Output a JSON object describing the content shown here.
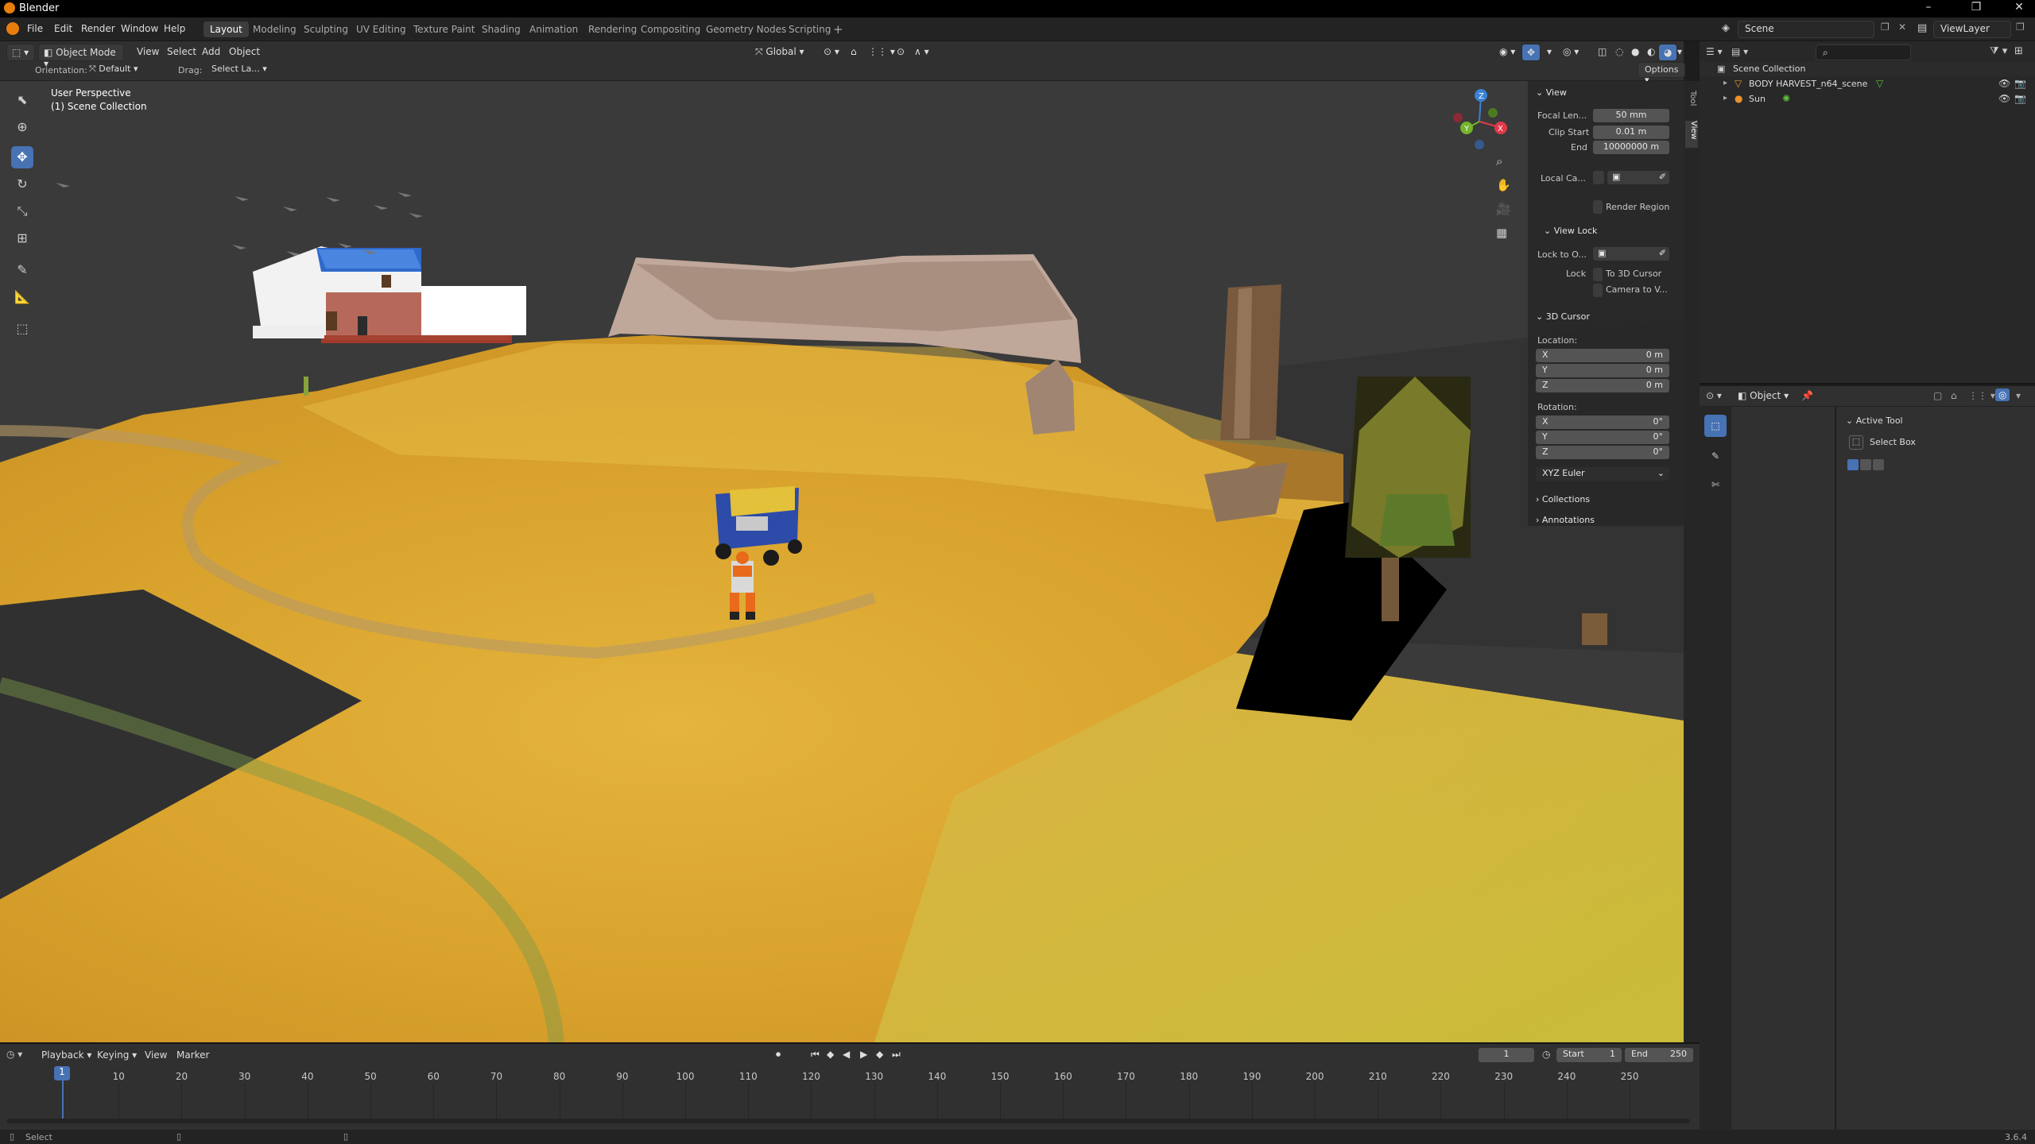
{
  "app": {
    "title": "Blender",
    "version": "3.6.4"
  },
  "menu": [
    "File",
    "Edit",
    "Render",
    "Window",
    "Help"
  ],
  "workspaces": [
    "Layout",
    "Modeling",
    "Sculpting",
    "UV Editing",
    "Texture Paint",
    "Shading",
    "Animation",
    "Rendering",
    "Compositing",
    "Geometry Nodes",
    "Scripting"
  ],
  "active_workspace": "Layout",
  "scene": {
    "name": "Scene",
    "view_layer": "ViewLayer"
  },
  "viewport_header": {
    "mode": "Object Mode",
    "menus": [
      "View",
      "Select",
      "Add",
      "Object"
    ],
    "transform_orientation": "Global",
    "orientation_label": "Orientation:",
    "orientation_value": "Default",
    "drag_label": "Drag:",
    "drag_value": "Select La...",
    "options_label": "Options"
  },
  "viewport": {
    "perspective": "User Perspective",
    "collection": "(1) Scene Collection"
  },
  "npanel": {
    "tabs": [
      "Tool",
      "View"
    ],
    "view_section": "View",
    "focal_label": "Focal Len...",
    "focal_value": "50 mm",
    "clip_start_label": "Clip Start",
    "clip_start_value": "0.01 m",
    "clip_end_label": "End",
    "clip_end_value": "10000000 m",
    "local_camera_label": "Local Ca...",
    "render_region_label": "Render Region",
    "view_lock_section": "View Lock",
    "lock_to_label": "Lock to O...",
    "lock_label": "Lock",
    "to_3d_cursor_label": "To 3D Cursor",
    "camera_to_view_label": "Camera to V...",
    "cursor_section": "3D Cursor",
    "location_label": "Location:",
    "loc_x": "0 m",
    "loc_y": "0 m",
    "loc_z": "0 m",
    "rotation_label": "Rotation:",
    "rot_x": "0°",
    "rot_y": "0°",
    "rot_z": "0°",
    "rotation_mode": "XYZ Euler",
    "collections_section": "Collections",
    "annotations_section": "Annotations",
    "axis_x": "X",
    "axis_y": "Y",
    "axis_z": "Z"
  },
  "outliner": {
    "root": "Scene Collection",
    "items": [
      {
        "name": "BODY HARVEST_n64_scene",
        "icon": "armature-icon"
      },
      {
        "name": "Sun",
        "icon": "sun-light-icon"
      }
    ]
  },
  "properties": {
    "context": "Object",
    "active_tool_section": "Active Tool",
    "active_tool_name": "Select Box"
  },
  "timeline": {
    "menus": [
      "Playback",
      "Keying",
      "View",
      "Marker"
    ],
    "current_frame": "1",
    "start_label": "Start",
    "start_value": "1",
    "end_label": "End",
    "end_value": "250",
    "ticks": [
      "1",
      "10",
      "20",
      "30",
      "40",
      "50",
      "60",
      "70",
      "80",
      "90",
      "100",
      "110",
      "120",
      "130",
      "140",
      "150",
      "160",
      "170",
      "180",
      "190",
      "200",
      "210",
      "220",
      "230",
      "240",
      "250"
    ]
  },
  "statusbar": {
    "left": "Select"
  },
  "colors": {
    "accent": "#4772b3",
    "gizmo_x": "#e0394a",
    "gizmo_y": "#75b32c",
    "gizmo_z": "#3b82d6"
  }
}
